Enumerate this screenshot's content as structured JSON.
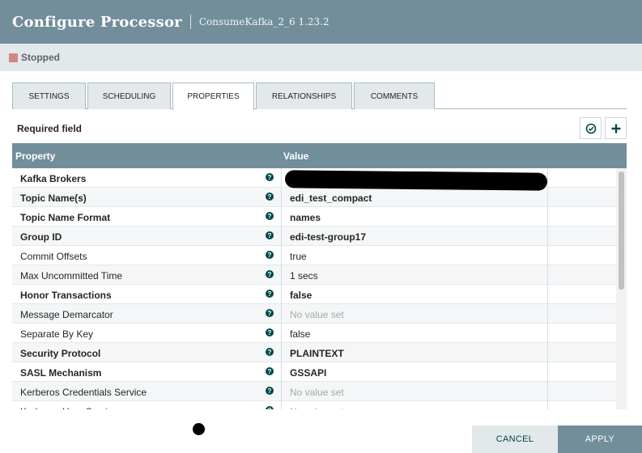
{
  "header": {
    "title": "Configure Processor",
    "subtitle": "ConsumeKafka_2_6 1.23.2"
  },
  "status": {
    "label": "Stopped"
  },
  "tabs": [
    {
      "label": "SETTINGS"
    },
    {
      "label": "SCHEDULING"
    },
    {
      "label": "PROPERTIES"
    },
    {
      "label": "RELATIONSHIPS"
    },
    {
      "label": "COMMENTS"
    }
  ],
  "active_tab": "PROPERTIES",
  "required_field": "Required field",
  "grid": {
    "col_property": "Property",
    "col_value": "Value",
    "rows": [
      {
        "property": "Kafka Brokers",
        "value": "",
        "required": true
      },
      {
        "property": "Topic Name(s)",
        "value": "edi_test_compact",
        "required": true
      },
      {
        "property": "Topic Name Format",
        "value": "names",
        "required": true
      },
      {
        "property": "Group ID",
        "value": "edi-test-group17",
        "required": true
      },
      {
        "property": "Commit Offsets",
        "value": "true",
        "required": false
      },
      {
        "property": "Max Uncommitted Time",
        "value": "1 secs",
        "required": false
      },
      {
        "property": "Honor Transactions",
        "value": "false",
        "required": true
      },
      {
        "property": "Message Demarcator",
        "value": "No value set",
        "required": false
      },
      {
        "property": "Separate By Key",
        "value": "false",
        "required": false
      },
      {
        "property": "Security Protocol",
        "value": "PLAINTEXT",
        "required": true
      },
      {
        "property": "SASL Mechanism",
        "value": "GSSAPI",
        "required": true
      },
      {
        "property": "Kerberos Credentials Service",
        "value": "No value set",
        "required": false
      },
      {
        "property": "Kerberos User Service",
        "value": "No value set",
        "required": false
      }
    ]
  },
  "buttons": {
    "cancel": "CANCEL",
    "apply": "APPLY"
  }
}
